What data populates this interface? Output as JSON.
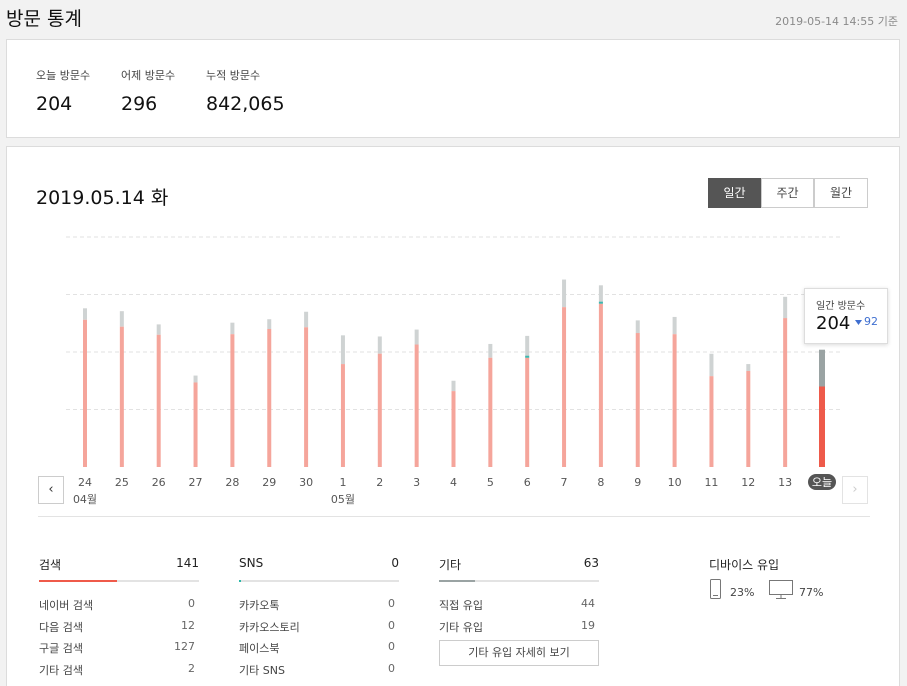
{
  "header": {
    "title": "방문 통계",
    "timestamp": "2019-05-14 14:55 기준"
  },
  "summary": [
    {
      "label": "오늘 방문수",
      "value": "204"
    },
    {
      "label": "어제 방문수",
      "value": "296"
    },
    {
      "label": "누적 방문수",
      "value": "842,065"
    }
  ],
  "main": {
    "date_title": "2019.05.14 화",
    "tabs": [
      {
        "label": "일간",
        "active": true
      },
      {
        "label": "주간",
        "active": false
      },
      {
        "label": "월간",
        "active": false
      }
    ]
  },
  "tooltip": {
    "label": "일간 방문수",
    "value": "204",
    "diff": "92"
  },
  "chart_data": {
    "type": "bar",
    "categories": [
      "24",
      "25",
      "26",
      "27",
      "28",
      "29",
      "30",
      "1",
      "2",
      "3",
      "4",
      "5",
      "6",
      "7",
      "8",
      "9",
      "10",
      "11",
      "12",
      "13",
      "오늘"
    ],
    "month_labels": [
      {
        "at": "24",
        "label": "04월"
      },
      {
        "at": "1",
        "label": "05월"
      }
    ],
    "series": [
      {
        "stack": "visits",
        "color": "#f5a59b",
        "values": [
          256,
          244,
          230,
          147,
          231,
          240,
          243,
          179,
          197,
          213,
          132,
          190,
          190,
          278,
          284,
          233,
          231,
          158,
          167,
          259,
          140
        ]
      },
      {
        "stack": "other",
        "color": "#cfd3d3",
        "values": [
          20,
          27,
          18,
          12,
          20,
          17,
          27,
          50,
          30,
          26,
          18,
          24,
          38,
          48,
          32,
          22,
          30,
          39,
          12,
          37,
          64
        ]
      }
    ],
    "today_colors": {
      "visits": "#ee5a4a",
      "other": "#9aa3a3"
    },
    "teal_marks": [
      "6",
      "8"
    ],
    "ylim": [
      0,
      400
    ],
    "grid": true
  },
  "nav": {
    "prev": "‹",
    "next": "›"
  },
  "groups": [
    {
      "title": "검색",
      "total": "141",
      "color": "#ef5a4a",
      "fill": 0.7,
      "rows": [
        {
          "label": "네이버 검색",
          "value": "0"
        },
        {
          "label": "다음 검색",
          "value": "12"
        },
        {
          "label": "구글 검색",
          "value": "127"
        },
        {
          "label": "기타 검색",
          "value": "2"
        }
      ]
    },
    {
      "title": "SNS",
      "total": "0",
      "color": "#2bb8a8",
      "fill": 0.01,
      "rows": [
        {
          "label": "카카오톡",
          "value": "0"
        },
        {
          "label": "카카오스토리",
          "value": "0"
        },
        {
          "label": "페이스북",
          "value": "0"
        },
        {
          "label": "기타 SNS",
          "value": "0"
        }
      ]
    },
    {
      "title": "기타",
      "total": "63",
      "color": "#9aa3a3",
      "fill": 0.32,
      "rows": [
        {
          "label": "직접 유입",
          "value": "44"
        },
        {
          "label": "기타 유입",
          "value": "19"
        }
      ]
    }
  ],
  "more_button": "기타 유입 자세히 보기",
  "device": {
    "title": "디바이스 유입",
    "mobile": "23%",
    "pc": "77%"
  }
}
